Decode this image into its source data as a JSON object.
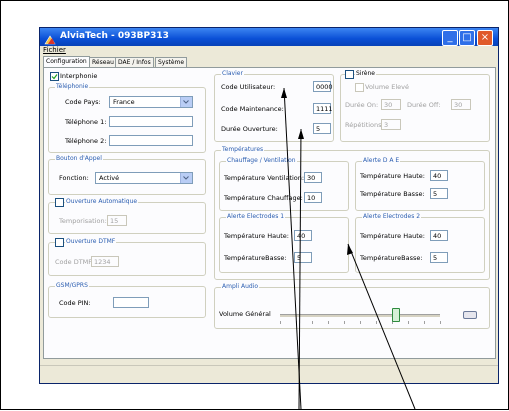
{
  "window": {
    "title": "AlviaTech - 093BP313"
  },
  "menu": {
    "file": "Fichier"
  },
  "tabs": [
    {
      "label": "Configuration",
      "active": true
    },
    {
      "label": "Réseau"
    },
    {
      "label": "DAE / Infos"
    },
    {
      "label": "Système"
    }
  ],
  "interphonie": {
    "label": "Interphonie",
    "checked": true
  },
  "telephonie": {
    "title": "Téléphonie",
    "code_pays_label": "Code Pays:",
    "code_pays_value": "France",
    "tel1_label": "Téléphone 1:",
    "tel2_label": "Téléphone 2:"
  },
  "bouton_appel": {
    "title": "Bouton d'Appel",
    "fonction_label": "Fonction:",
    "fonction_value": "Activé"
  },
  "ouverture_auto": {
    "label": "Ouverture Automatique",
    "temporisation_label": "Temporisation:",
    "temporisation_value": "15"
  },
  "ouverture_dtmf": {
    "label": "Ouverture DTMF",
    "code_label": "Code DTMF:",
    "code_value": "1234"
  },
  "gsm": {
    "title": "GSM/GPRS",
    "pin_label": "Code PIN:"
  },
  "clavier": {
    "title": "Clavier",
    "code_util_label": "Code Utilisateur:",
    "code_util_value": "0000",
    "code_maint_label": "Code Maintenance:",
    "code_maint_value": "1111",
    "duree_label": "Durée Ouverture:",
    "duree_value": "5"
  },
  "sirene": {
    "label": "Sirène",
    "volume_label": "Volume Elevé",
    "duree_on_label": "Durée On:",
    "duree_on_value": "30",
    "duree_off_label": "Durée Off:",
    "duree_off_value": "30",
    "repetitions_label": "Répétitions:",
    "repetitions_value": "3"
  },
  "temperatures": {
    "title": "Températures",
    "chauffage": {
      "title": "Chauffage / Ventilation",
      "vent_label": "Température Ventilation:",
      "vent_value": "30",
      "chauf_label": "Température Chauffage:",
      "chauf_value": "10"
    },
    "alerte_dae": {
      "title": "Alerte D A E",
      "haute_label": "Température Haute:",
      "haute_value": "40",
      "basse_label": "Température Basse:",
      "basse_value": "5"
    },
    "electrodes1": {
      "title": "Alerte Electrodes 1",
      "haute_label": "Température Haute:",
      "haute_value": "40",
      "basse_label": "TempératureBasse:",
      "basse_value": "5"
    },
    "electrodes2": {
      "title": "Alerte Electrodes 2",
      "haute_label": "Température Haute:",
      "haute_value": "40",
      "basse_label": "TempératureBasse:",
      "basse_value": "5"
    }
  },
  "ampli": {
    "title": "Ampli Audio",
    "volume_label": "Volume Général",
    "volume_level": 0.72
  },
  "colors": {
    "titlebar": "#0a4fd6",
    "group_title": "#2a5db0"
  }
}
